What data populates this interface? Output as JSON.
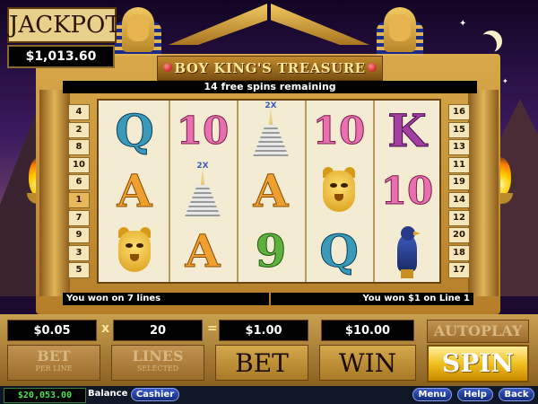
{
  "game": {
    "title": "BOY KING'S TREASURE",
    "jackpot_label": "JACKPOT",
    "jackpot_value": "$1,013.60",
    "free_spins_text": "14 free spins remaining"
  },
  "paylines": {
    "left": [
      "4",
      "2",
      "8",
      "10",
      "6",
      "1",
      "7",
      "9",
      "3",
      "5"
    ],
    "right": [
      "16",
      "15",
      "13",
      "11",
      "19",
      "14",
      "12",
      "20",
      "18",
      "17"
    ]
  },
  "reels": [
    [
      {
        "type": "Q",
        "icon": "queen-card-icon"
      },
      {
        "type": "A",
        "icon": "ace-card-icon"
      },
      {
        "type": "lion",
        "icon": "golden-lion-mask-icon"
      }
    ],
    [
      {
        "type": "10",
        "icon": "ten-card-icon"
      },
      {
        "type": "wild",
        "icon": "pharaoh-staircase-wild-icon",
        "multiplier": "2X"
      },
      {
        "type": "A",
        "icon": "ace-card-icon"
      }
    ],
    [
      {
        "type": "wild",
        "icon": "pharaoh-staircase-wild-icon",
        "multiplier": "2X"
      },
      {
        "type": "A",
        "icon": "ace-card-icon"
      },
      {
        "type": "9",
        "icon": "nine-card-icon"
      }
    ],
    [
      {
        "type": "10",
        "icon": "ten-card-icon"
      },
      {
        "type": "lion",
        "icon": "golden-lion-mask-icon"
      },
      {
        "type": "Q",
        "icon": "queen-card-icon"
      }
    ],
    [
      {
        "type": "K",
        "icon": "king-card-icon"
      },
      {
        "type": "10",
        "icon": "ten-card-icon"
      },
      {
        "type": "bird",
        "icon": "falcon-icon"
      }
    ]
  ],
  "messages": {
    "left": "You won on 7 lines",
    "right": "You won $1 on Line 1"
  },
  "controls": {
    "bet_per_line_value": "$0.05",
    "multiply_sign": "x",
    "lines_selected_value": "20",
    "equals_sign": "=",
    "bet_value": "$1.00",
    "win_value": "$10.00",
    "bet_per_line_label": "BET",
    "bet_per_line_sub": "PER LINE",
    "lines_label": "LINES",
    "lines_sub": "SELECTED",
    "bet_label": "BET",
    "win_label": "WIN",
    "autoplay_label": "AUTOPLAY",
    "spin_label": "SPIN"
  },
  "footer": {
    "balance_value": "$20,053.00",
    "balance_label": "Balance",
    "cashier_label": "Cashier",
    "menu_label": "Menu",
    "help_label": "Help",
    "back_label": "Back"
  },
  "colors": {
    "sky_top": "#120523",
    "gold": "#d8a84a",
    "spin_yellow": "#f0c020",
    "balance_green": "#4fe04f",
    "footer_button_blue": "#2a4ab0"
  }
}
